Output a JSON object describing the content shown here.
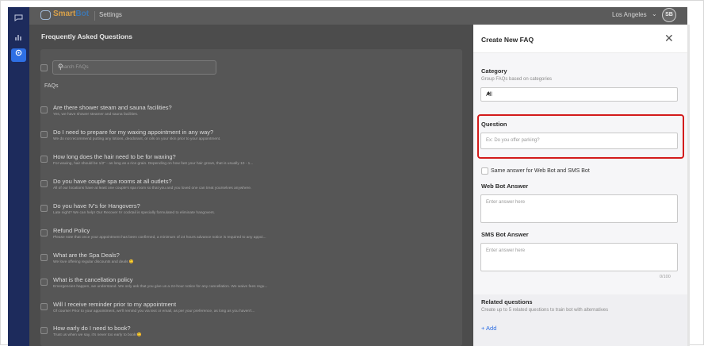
{
  "app": {
    "logo_prefix": "Smart",
    "logo_suffix": "Bot",
    "breadcrumb": "Settings",
    "location": "Los Angeles",
    "avatar_initials": "SB"
  },
  "main": {
    "title": "Frequently Asked Questions",
    "search_placeholder": "Search FAQs",
    "column_header": "FAQs",
    "faqs": [
      {
        "question": "Are there shower steam and sauna facilities?",
        "answer": "Yes, we have shower steamer and sauna facilities."
      },
      {
        "question": "Do I need to prepare for my waxing appointment in any way?",
        "answer": "We do not recommend putting any lotions, deodorant, or oils on your skin prior to your appointment."
      },
      {
        "question": "How long does the hair need to be for waxing?",
        "answer": "For waxing, hair should be 1/2\" - as long as a rice grain. Depending on how fast your hair grows, that is usually 10 - 1..."
      },
      {
        "question": "Do you have couple spa rooms at all outlets?",
        "answer": "All of our locations have at least one couple's spa room so that you and you loved one can treat yourselves anywhere."
      },
      {
        "question": "Do you have IV's for Hangovers?",
        "answer": "Late night? We can help! Our Recover IV cocktail is specially formulated to eliminate hangovers."
      },
      {
        "question": "Refund Policy",
        "answer": "Please note that once your appointment has been confirmed, a minimum of 24 hours advance notice is required to any appoi..."
      },
      {
        "question": "What are the Spa Deals?",
        "answer": "We love offering regular discounts and deals 😊"
      },
      {
        "question": "What is the cancellation policy",
        "answer": "Emergencies happen, we understand. We only ask that you give us a 24-hour notice for any cancellation. We waive fees regu..."
      },
      {
        "question": "Will I receive reminder prior to my appointment",
        "answer": "Of course! Prior to your appointment, we'll remind you via text or email, as per your preference, as long as you haven't..."
      },
      {
        "question": "How early do I need to book?",
        "answer": "Trust us when we say, it's never too early to book!😊"
      }
    ]
  },
  "panel": {
    "title": "Create New FAQ",
    "category_label": "Category",
    "category_help": "Group FAQs based on categories",
    "category_value": "All",
    "question_label": "Question",
    "question_placeholder": "Ex: Do you offer parking?",
    "same_answer_label": "Same answer for Web Bot and SMS Bot",
    "web_answer_label": "Web Bot Answer",
    "web_answer_placeholder": "Enter answer here",
    "sms_answer_label": "SMS Bot Answer",
    "sms_answer_placeholder": "Enter answer here",
    "sms_counter": "0/100",
    "related_label": "Related questions",
    "related_help": "Create up to 5 related questions to train bot with alternatives",
    "add_label": "+ Add"
  },
  "colors": {
    "rail": "#1d2b5c",
    "accent": "#2e6fe4",
    "highlight": "#d31b1b"
  }
}
